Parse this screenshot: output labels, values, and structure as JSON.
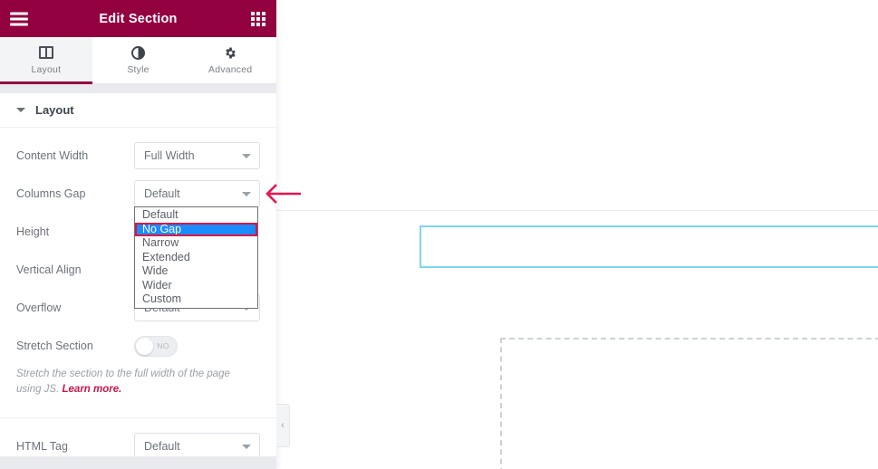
{
  "panel": {
    "header": {
      "title": "Edit Section",
      "menu_icon": "hamburger-icon",
      "grid_icon": "grid-icon"
    },
    "tabs": [
      {
        "label": "Layout",
        "icon": "columns-icon",
        "active": true
      },
      {
        "label": "Style",
        "icon": "contrast-icon",
        "active": false
      },
      {
        "label": "Advanced",
        "icon": "gear-icon",
        "active": false
      }
    ],
    "section": {
      "title": "Layout",
      "caret": "chevron-down-icon"
    },
    "controls": [
      {
        "label": "Content Width",
        "value": "Full Width"
      },
      {
        "label": "Columns Gap",
        "value": "Default"
      },
      {
        "label": "Height",
        "value": ""
      },
      {
        "label": "Vertical Align",
        "value": ""
      },
      {
        "label": "Overflow",
        "value": "Default"
      }
    ],
    "stretch": {
      "label": "Stretch Section",
      "toggle_state": "NO",
      "help_prefix": "Stretch the section to the full width of the page using JS. ",
      "help_link": "Learn more."
    },
    "html_tag": {
      "label": "HTML Tag",
      "value": "Default"
    },
    "collapse_handle_icon": "chevron-left-icon"
  },
  "dropdown": {
    "open": true,
    "selected": "No Gap",
    "options": [
      "Default",
      "No Gap",
      "Narrow",
      "Extended",
      "Wide",
      "Wider",
      "Custom"
    ]
  },
  "canvas": {
    "selected_section_label": "selected-section-outline",
    "placeholder_label": "empty-widget-dropzone"
  },
  "annotation": {
    "type": "arrow-left",
    "color": "#e8134f"
  },
  "colors": {
    "header_bg": "#93003f",
    "accent": "#93003f",
    "link": "#c9164a",
    "dropdown_highlight": "#1a8cff",
    "dropdown_outline": "#e0113f",
    "section_outline": "#7ed3f7",
    "dashed_outline": "#ccd1d8"
  }
}
